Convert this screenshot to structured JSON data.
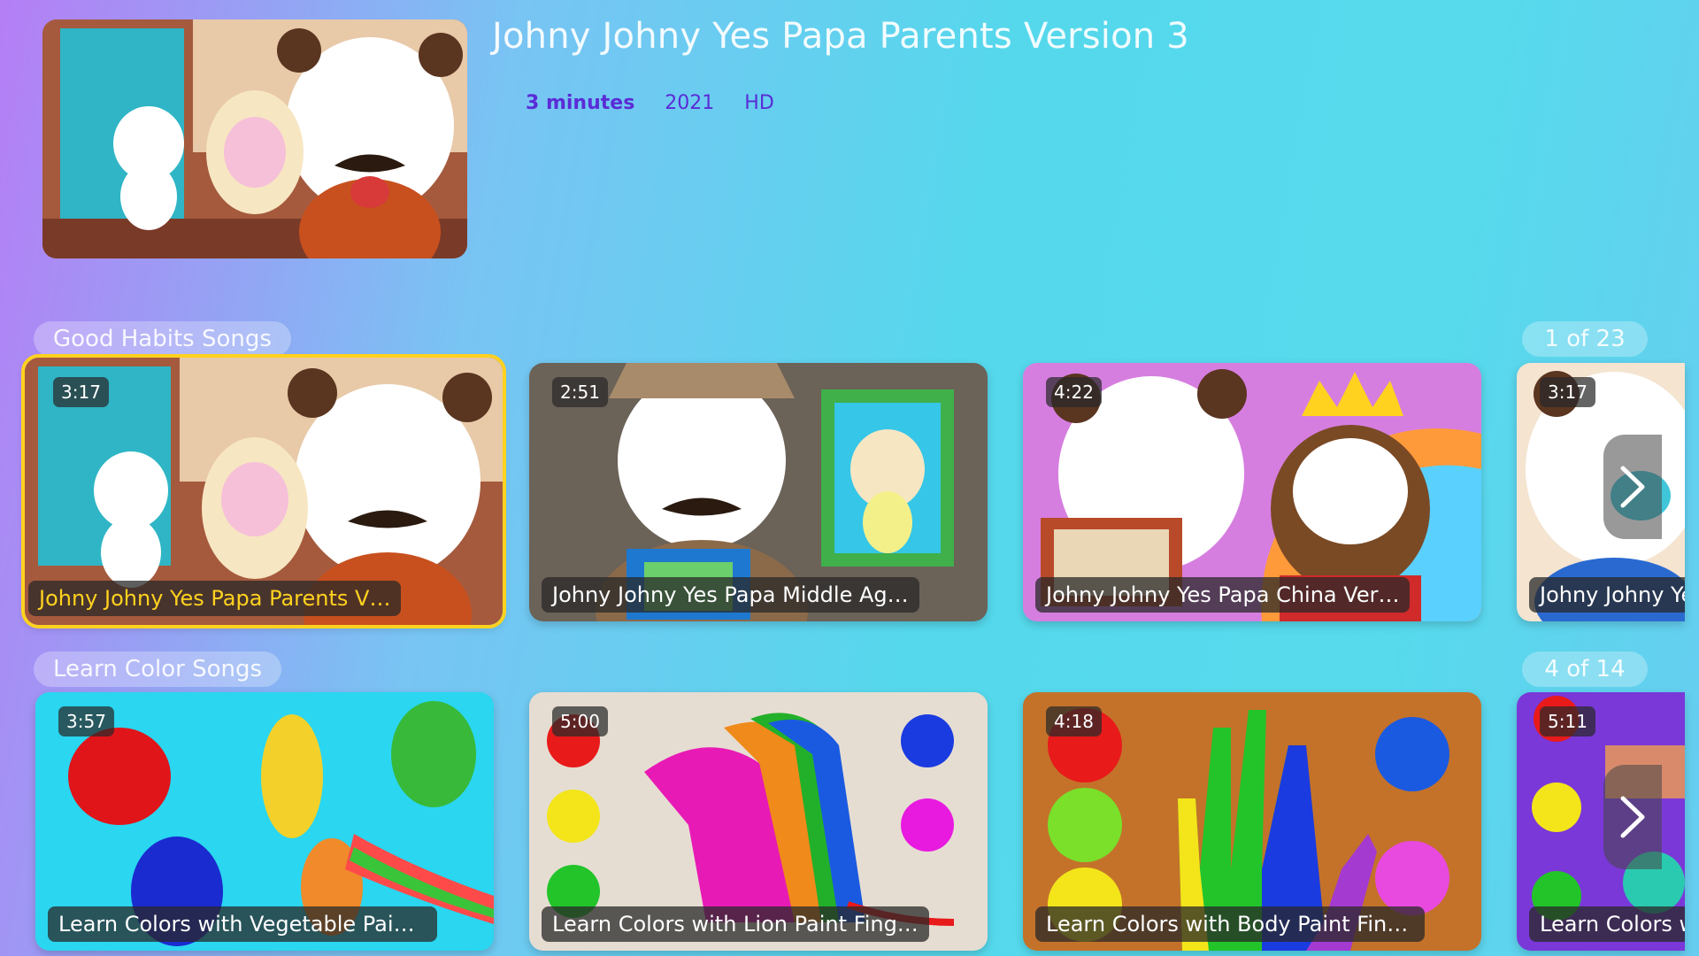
{
  "hero": {
    "title": "Johny Johny Yes Papa Parents Version 3",
    "duration": "3 minutes",
    "year": "2021",
    "quality": "HD"
  },
  "rows": [
    {
      "label": "Good Habits Songs",
      "counter": "1 of 23",
      "cards": [
        {
          "duration": "3:17",
          "title": "Johny Johny Yes Papa Parents V…"
        },
        {
          "duration": "2:51",
          "title": "Johny Johny Yes Papa Middle Ag…"
        },
        {
          "duration": "4:22",
          "title": "Johny Johny Yes Papa China Ver…"
        },
        {
          "duration": "3:17",
          "title": "Johny Johny Ye"
        }
      ]
    },
    {
      "label": "Learn Color Songs",
      "counter": "4 of 14",
      "cards": [
        {
          "duration": "3:57",
          "title": "Learn Colors with Vegetable Paint…"
        },
        {
          "duration": "5:00",
          "title": "Learn Colors with Lion Paint Fing…"
        },
        {
          "duration": "4:18",
          "title": "Learn Colors with Body Paint Fing…"
        },
        {
          "duration": "5:11",
          "title": "Learn Colors w"
        }
      ]
    }
  ],
  "icons": {
    "next": "chevron-right-icon"
  },
  "colors": {
    "selected_outline": "#ffd21f",
    "meta_text": "#5a2cd6"
  }
}
